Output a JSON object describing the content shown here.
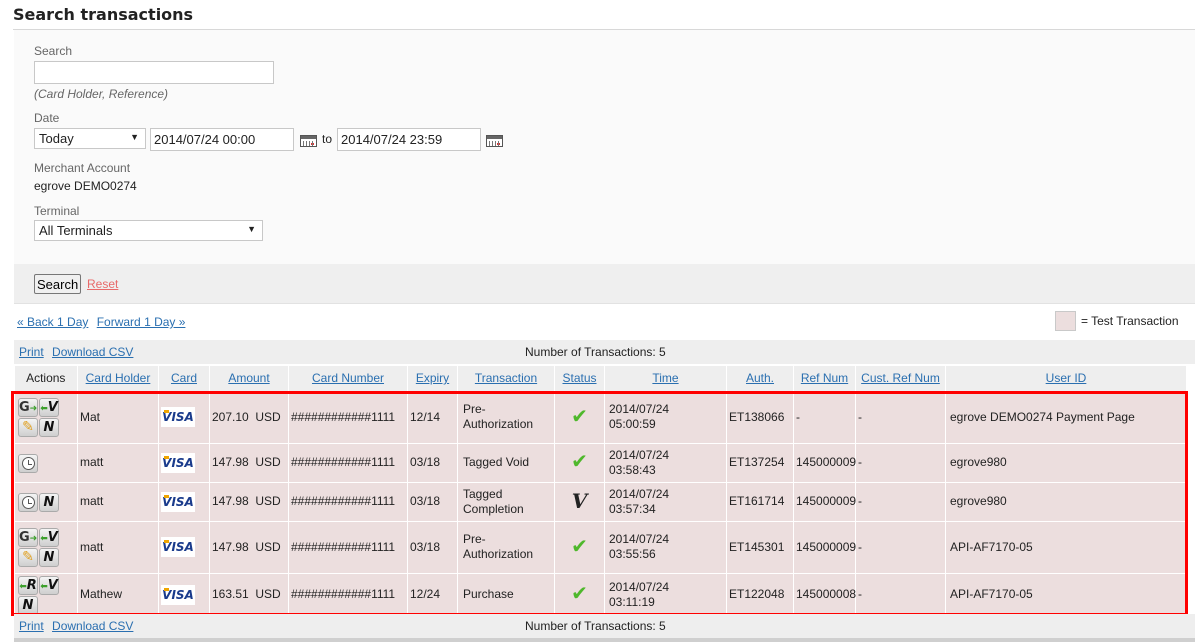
{
  "page": {
    "title": "Search transactions"
  },
  "search_form": {
    "search_label": "Search",
    "search_value": "",
    "search_hint": "(Card Holder, Reference)",
    "date_label": "Date",
    "date_range_selected": "Today",
    "date_from": "2014/07/24 00:00",
    "date_to": "2014/07/24 23:59",
    "to_label": "to",
    "merchant_label": "Merchant Account",
    "merchant_value": "egrove DEMO0274",
    "terminal_label": "Terminal",
    "terminal_selected": "All Terminals",
    "search_button": "Search",
    "reset_link": "Reset"
  },
  "navigation": {
    "back": "« Back 1 Day",
    "forward": "Forward 1 Day »"
  },
  "legend": {
    "label": "= Test Transaction",
    "color": "#ecdede"
  },
  "toolbar": {
    "print": "Print",
    "download_csv": "Download CSV",
    "count_text": "Number of Transactions: 5"
  },
  "table": {
    "columns": [
      "Actions",
      "Card Holder",
      "Card",
      "Amount",
      "Card Number",
      "Expiry",
      "Transaction",
      "Status",
      "Time",
      "Auth.",
      "Ref Num",
      "Cust. Ref Num",
      "User ID"
    ],
    "rows": [
      {
        "actions": [
          "refund-icon",
          "void-icon",
          "edit-icon",
          "note-icon"
        ],
        "card_holder": "Mat",
        "card": "VISA",
        "amount": "207.10",
        "currency": "USD",
        "card_number": "############1111",
        "expiry": "12/14",
        "transaction": "Pre-Authorization",
        "status": "approved",
        "date": "2014/07/24",
        "time": "05:00:59",
        "auth": "ET138066",
        "ref_num": "-",
        "cust_ref_num": "-",
        "user_id": "egrove DEMO0274 Payment Page"
      },
      {
        "actions": [
          "history-icon"
        ],
        "card_holder": "matt",
        "card": "VISA",
        "amount": "147.98",
        "currency": "USD",
        "card_number": "############1111",
        "expiry": "03/18",
        "transaction": "Tagged Void",
        "status": "approved",
        "date": "2014/07/24",
        "time": "03:58:43",
        "auth": "ET137254",
        "ref_num": "145000009",
        "cust_ref_num": "-",
        "user_id": "egrove980"
      },
      {
        "actions": [
          "history-icon",
          "note-icon"
        ],
        "card_holder": "matt",
        "card": "VISA",
        "amount": "147.98",
        "currency": "USD",
        "card_number": "############1111",
        "expiry": "03/18",
        "transaction": "Tagged Completion",
        "status": "voided",
        "date": "2014/07/24",
        "time": "03:57:34",
        "auth": "ET161714",
        "ref_num": "145000009",
        "cust_ref_num": "-",
        "user_id": "egrove980"
      },
      {
        "actions": [
          "refund-icon",
          "void-icon",
          "edit-icon",
          "note-icon"
        ],
        "card_holder": "matt",
        "card": "VISA",
        "amount": "147.98",
        "currency": "USD",
        "card_number": "############1111",
        "expiry": "03/18",
        "transaction": "Pre-Authorization",
        "status": "approved",
        "date": "2014/07/24",
        "time": "03:55:56",
        "auth": "ET145301",
        "ref_num": "145000009",
        "cust_ref_num": "-",
        "user_id": "API-AF7170-05"
      },
      {
        "actions": [
          "return-icon",
          "void-icon",
          "note-icon"
        ],
        "card_holder": "Mathew",
        "card": "VISA",
        "amount": "163.51",
        "currency": "USD",
        "card_number": "############1111",
        "expiry": "12/24",
        "transaction": "Purchase",
        "status": "approved",
        "date": "2014/07/24",
        "time": "03:11:19",
        "auth": "ET122048",
        "ref_num": "145000008",
        "cust_ref_num": "-",
        "user_id": "API-AF7170-05"
      }
    ]
  },
  "colors": {
    "link": "#2a6fb0",
    "reset": "#e86a6a",
    "highlight_frame": "#ff0000",
    "approved": "#4fb82c"
  }
}
